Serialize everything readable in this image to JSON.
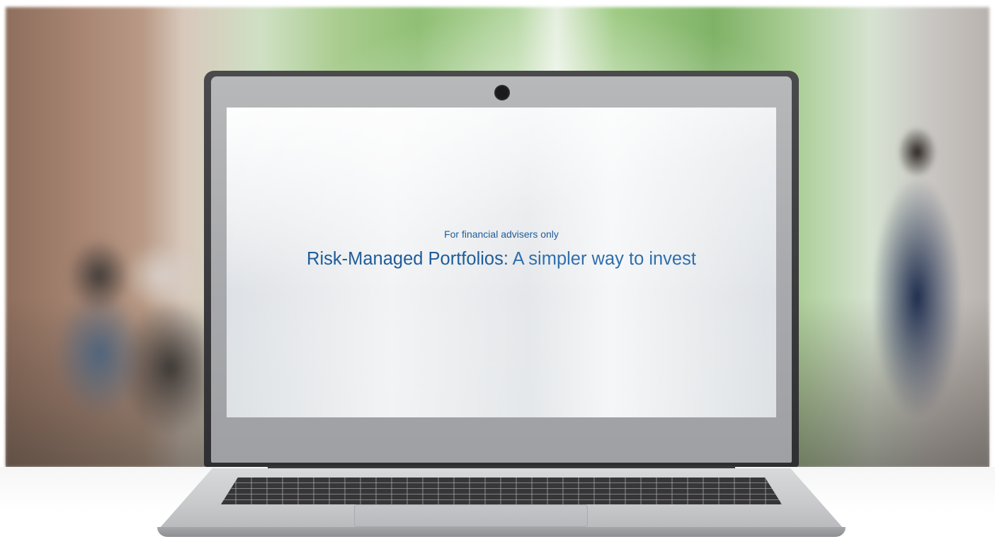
{
  "screen": {
    "overline": "For financial advisers only",
    "headline_strong": "Risk-Managed Portfolios:",
    "headline_rest": " A simpler way to invest"
  },
  "colors": {
    "text_blue": "#1f5c99",
    "bezel_silver": "#a9aaad",
    "background": "#ffffff"
  }
}
